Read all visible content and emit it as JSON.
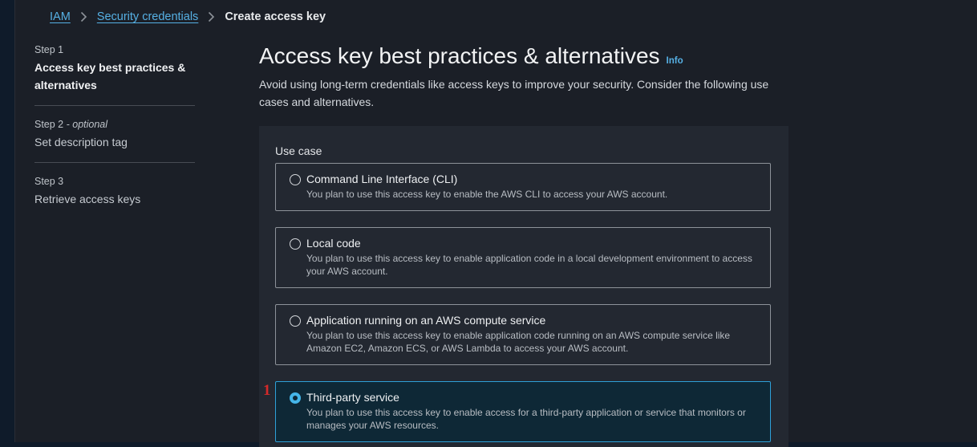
{
  "breadcrumb": {
    "items": [
      "IAM",
      "Security credentials"
    ],
    "current": "Create access key"
  },
  "steps": [
    {
      "meta": "Step 1",
      "optional": "",
      "title": "Access key best practices & alternatives"
    },
    {
      "meta": "Step 2",
      "optional": " - optional",
      "title": "Set description tag"
    },
    {
      "meta": "Step 3",
      "optional": "",
      "title": "Retrieve access keys"
    }
  ],
  "header": {
    "title": "Access key best practices & alternatives",
    "info": "Info",
    "description": "Avoid using long-term credentials like access keys to improve your security. Consider the following use cases and alternatives."
  },
  "use_case": {
    "label": "Use case",
    "options": [
      {
        "title": "Command Line Interface (CLI)",
        "description": "You plan to use this access key to enable the AWS CLI to access your AWS account.",
        "selected": false
      },
      {
        "title": "Local code",
        "description": "You plan to use this access key to enable application code in a local development environment to access your AWS account.",
        "selected": false
      },
      {
        "title": "Application running on an AWS compute service",
        "description": "You plan to use this access key to enable application code running on an AWS compute service like Amazon EC2, Amazon ECS, or AWS Lambda to access your AWS account.",
        "selected": false
      },
      {
        "title": "Third-party service",
        "description": "You plan to use this access key to enable access for a third-party application or service that monitors or manages your AWS resources.",
        "selected": true
      }
    ]
  },
  "annotation": "1",
  "colors": {
    "accent": "#56b0e4",
    "selected_border": "#2ea0d8",
    "annotation": "#d42a2a"
  }
}
